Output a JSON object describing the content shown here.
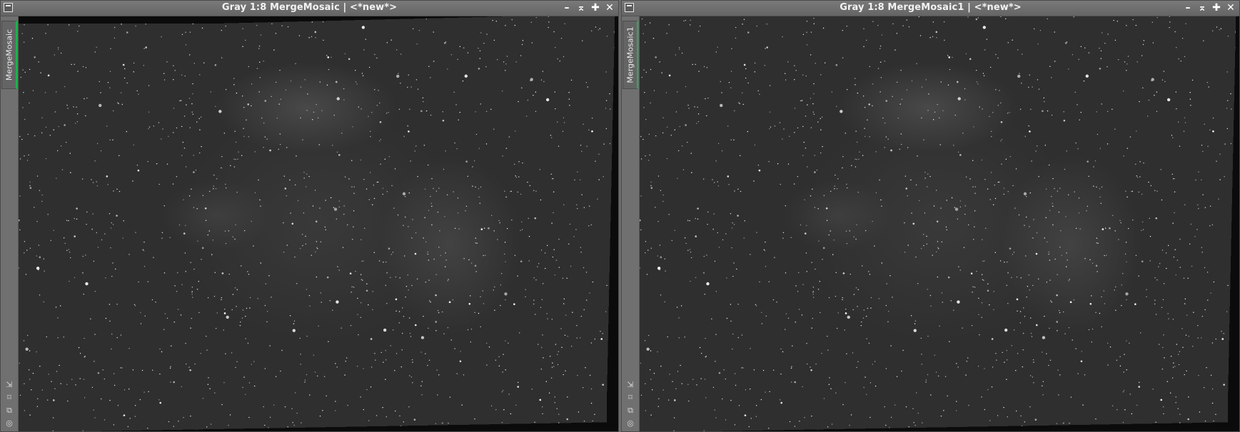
{
  "windows": [
    {
      "title": "Gray 1:8 MergeMosaic | <*new*>",
      "side_tab_label": "MergeMosaic"
    },
    {
      "title": "Gray 1:8 MergeMosaic1 | <*new*>",
      "side_tab_label": "MergeMosaic1"
    }
  ],
  "controls": {
    "minimize": "–",
    "shade": "⌅",
    "maximize": "✚",
    "close": "✕"
  },
  "side_tools": [
    "⇲",
    "⌑",
    "⧉",
    "◎"
  ],
  "colors": {
    "active_tab_accent": "#1db34c",
    "titlebar": "#6e6e6e",
    "image_background": "#2f2f2f"
  }
}
